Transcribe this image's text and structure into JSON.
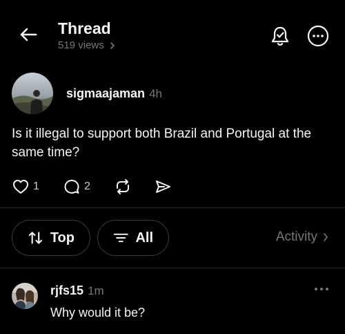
{
  "header": {
    "title": "Thread",
    "views": "519 views",
    "back_icon": "arrow-left-icon",
    "bell_icon": "bell-check-icon",
    "more_icon": "more-circle-icon"
  },
  "post": {
    "author": "sigmaajaman",
    "time": "4h",
    "text": "Is it illegal to support both Brazil and Portugal at the same time?",
    "likes": "1",
    "replies": "2"
  },
  "filters": {
    "sort_label": "Top",
    "filter_label": "All",
    "activity_label": "Activity"
  },
  "reply": {
    "author": "rjfs15",
    "time": "1m",
    "text": "Why would it be?"
  },
  "colors": {
    "background": "#000000",
    "text": "#f3f5f7",
    "muted": "#777777",
    "border": "#3a3a3a"
  }
}
